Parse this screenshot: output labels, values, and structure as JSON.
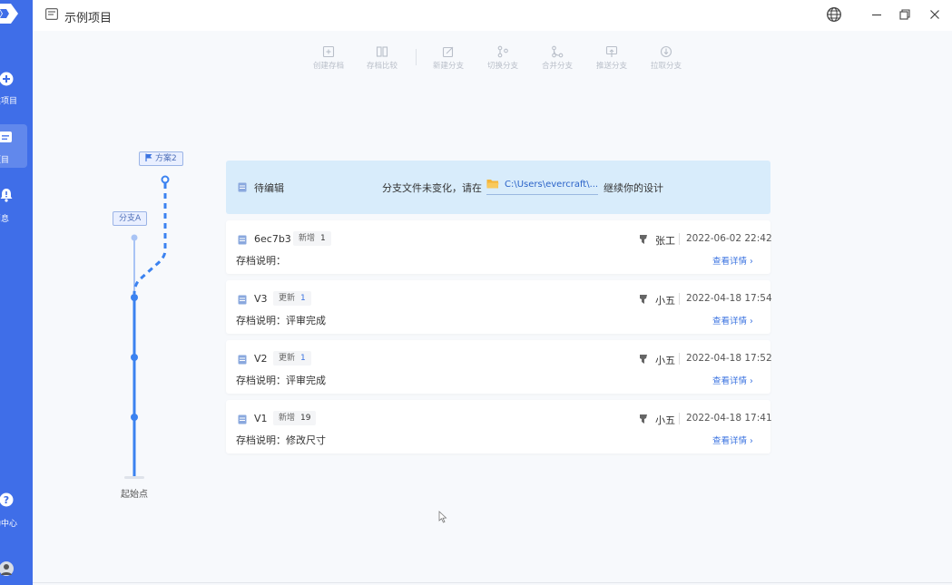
{
  "app": {
    "title": "示例项目"
  },
  "sidebar": {
    "items": [
      {
        "label": "建项目",
        "icon": "plus-circle-icon"
      },
      {
        "label": "项目",
        "icon": "project-icon",
        "active": true
      },
      {
        "label": "消息",
        "icon": "bell-icon"
      },
      {
        "label": "助中心",
        "icon": "help-icon"
      }
    ]
  },
  "toolbar": {
    "items": [
      {
        "label": "创建存档",
        "icon": "create-archive-icon"
      },
      {
        "label": "存档比较",
        "icon": "compare-archive-icon"
      },
      {
        "label": "新建分支",
        "icon": "new-branch-icon"
      },
      {
        "label": "切换分支",
        "icon": "switch-branch-icon"
      },
      {
        "label": "合并分支",
        "icon": "merge-branch-icon"
      },
      {
        "label": "推送分支",
        "icon": "push-branch-icon"
      },
      {
        "label": "拉取分支",
        "icon": "pull-branch-icon"
      }
    ]
  },
  "tree": {
    "branch_tag": "分支A",
    "plan_tag": "方案2",
    "origin_label": "起始点"
  },
  "pending": {
    "title": "待编辑",
    "message": "分支文件未变化，请在",
    "path": "C:\\Users\\evercraft\\...",
    "message_end": "继续你的设计"
  },
  "commits": [
    {
      "version": "6ec7b3",
      "change_label": "新增",
      "change_count": "1",
      "change_type": "add",
      "user": "张工",
      "time": "2022-06-02 22:42",
      "desc": "存档说明：",
      "detail": "查看详情 ›"
    },
    {
      "version": "V3",
      "change_label": "更新",
      "change_count": "1",
      "change_type": "update",
      "user": "小五",
      "time": "2022-04-18 17:54",
      "desc": "存档说明：评审完成",
      "detail": "查看详情 ›"
    },
    {
      "version": "V2",
      "change_label": "更新",
      "change_count": "1",
      "change_type": "update",
      "user": "小五",
      "time": "2022-04-18 17:52",
      "desc": "存档说明：评审完成",
      "detail": "查看详情 ›"
    },
    {
      "version": "V1",
      "change_label": "新增",
      "change_count": "19",
      "change_type": "add",
      "user": "小五",
      "time": "2022-04-18 17:41",
      "desc": "存档说明：修改尺寸",
      "detail": "查看详情 ›"
    }
  ],
  "colors": {
    "sidebar": "#3f6ee8",
    "accent": "#3b73e0",
    "pending_bg": "#d8ecfb",
    "tree_line": "#3b82f0"
  }
}
